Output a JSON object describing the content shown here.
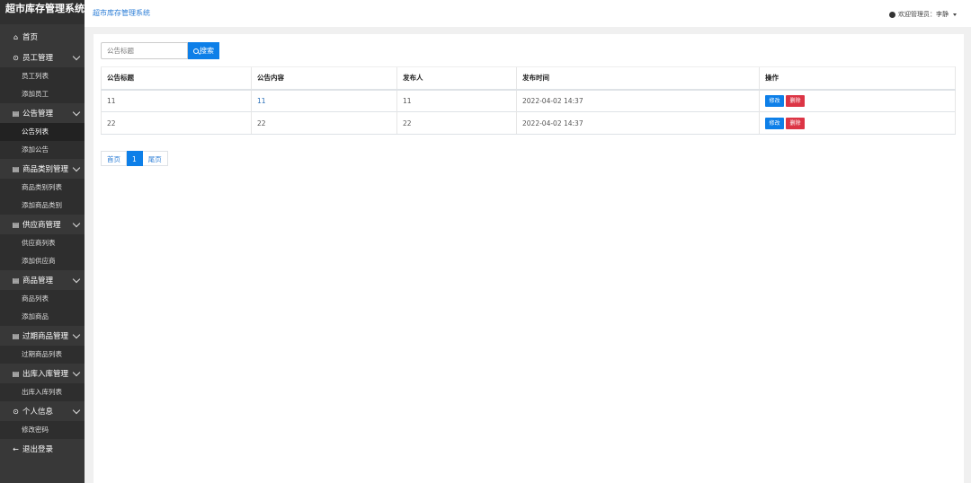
{
  "app": {
    "title": "超市库存管理系统"
  },
  "sidebar": {
    "groups": [
      {
        "label": "首页",
        "icon": "home-icon",
        "items": []
      },
      {
        "label": "员工管理",
        "icon": "gear-icon",
        "items": [
          "员工列表",
          "添加员工"
        ]
      },
      {
        "label": "公告管理",
        "icon": "document-icon",
        "items": [
          "公告列表",
          "添加公告"
        ]
      },
      {
        "label": "商品类别管理",
        "icon": "document-icon",
        "items": [
          "商品类别列表",
          "添加商品类别"
        ]
      },
      {
        "label": "供应商管理",
        "icon": "document-icon",
        "items": [
          "供应商列表",
          "添加供应商"
        ]
      },
      {
        "label": "商品管理",
        "icon": "document-icon",
        "items": [
          "商品列表",
          "添加商品"
        ]
      },
      {
        "label": "过期商品管理",
        "icon": "document-icon",
        "items": [
          "过期商品列表"
        ]
      },
      {
        "label": "出库入库管理",
        "icon": "document-icon",
        "items": [
          "出库入库列表"
        ]
      },
      {
        "label": "个人信息",
        "icon": "gear-icon",
        "items": [
          "修改密码"
        ]
      },
      {
        "label": "退出登录",
        "icon": "arrow-left-icon",
        "items": []
      }
    ],
    "active_item": "公告列表"
  },
  "header": {
    "breadcrumb": "超市库存管理系统",
    "user_label": "欢迎管理员：李静"
  },
  "search": {
    "placeholder": "公告标题",
    "button_label": "搜索"
  },
  "table": {
    "columns": [
      "公告标题",
      "公告内容",
      "发布人",
      "发布时间",
      "操作"
    ],
    "rows": [
      {
        "title": "11",
        "content": "11",
        "publisher": "11",
        "time": "2022-04-02 14:37"
      },
      {
        "title": "22",
        "content": "22",
        "publisher": "22",
        "time": "2022-04-02 14:37"
      }
    ],
    "edit_label": "修改",
    "delete_label": "删除"
  },
  "pagination": {
    "first": "首页",
    "current": "1",
    "last": "尾页"
  },
  "colors": {
    "primary": "#0d7fe8",
    "danger": "#dc3545",
    "sidebar": "#383838"
  }
}
